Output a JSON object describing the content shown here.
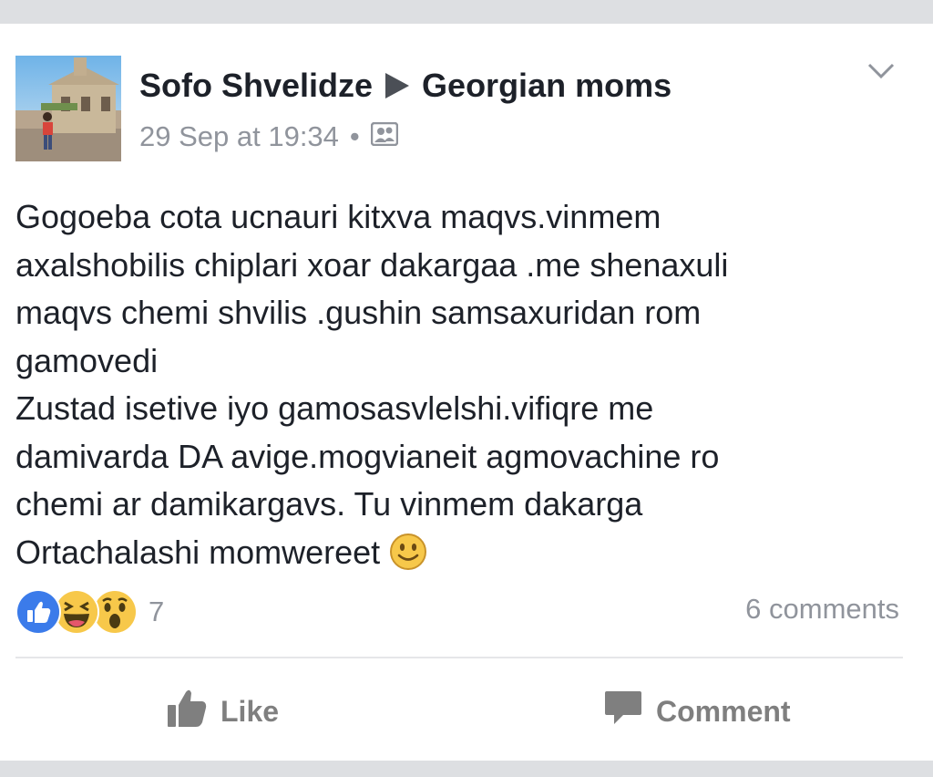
{
  "post": {
    "author": "Sofo Shvelidze",
    "group": "Georgian moms",
    "timestamp": "29 Sep at 19:34",
    "separator": "•",
    "audience_icon": "group-audience-icon",
    "menu_icon": "chevron-down-icon",
    "body_lines": [
      "Gogoeba cota ucnauri kitxva maqvs.vinmem",
      "axalshobilis chiplari xoar dakargaa .me shenaxuli",
      "maqvs chemi shvilis .gushin samsaxuridan rom",
      "gamovedi",
      "Zustad isetive iyo gamosasvlelshi.vifiqre me",
      "damivarda DA avige.mogvianeit agmovachine ro",
      "chemi ar damikargavs. Tu vinmem dakarga",
      "Ortachalashi momwereet"
    ],
    "emoji": "slightly-smiling-face"
  },
  "footer": {
    "reaction_icons": [
      "like-icon",
      "haha-icon",
      "wow-icon"
    ],
    "reaction_count": "7",
    "comments": "6 comments",
    "like_label": "Like",
    "comment_label": "Comment"
  },
  "colors": {
    "text": "#1d2129",
    "meta": "#90949c",
    "like_blue": "#3b7bea",
    "emoji_yellow": "#f7c84a",
    "background": "#dddfe2"
  }
}
